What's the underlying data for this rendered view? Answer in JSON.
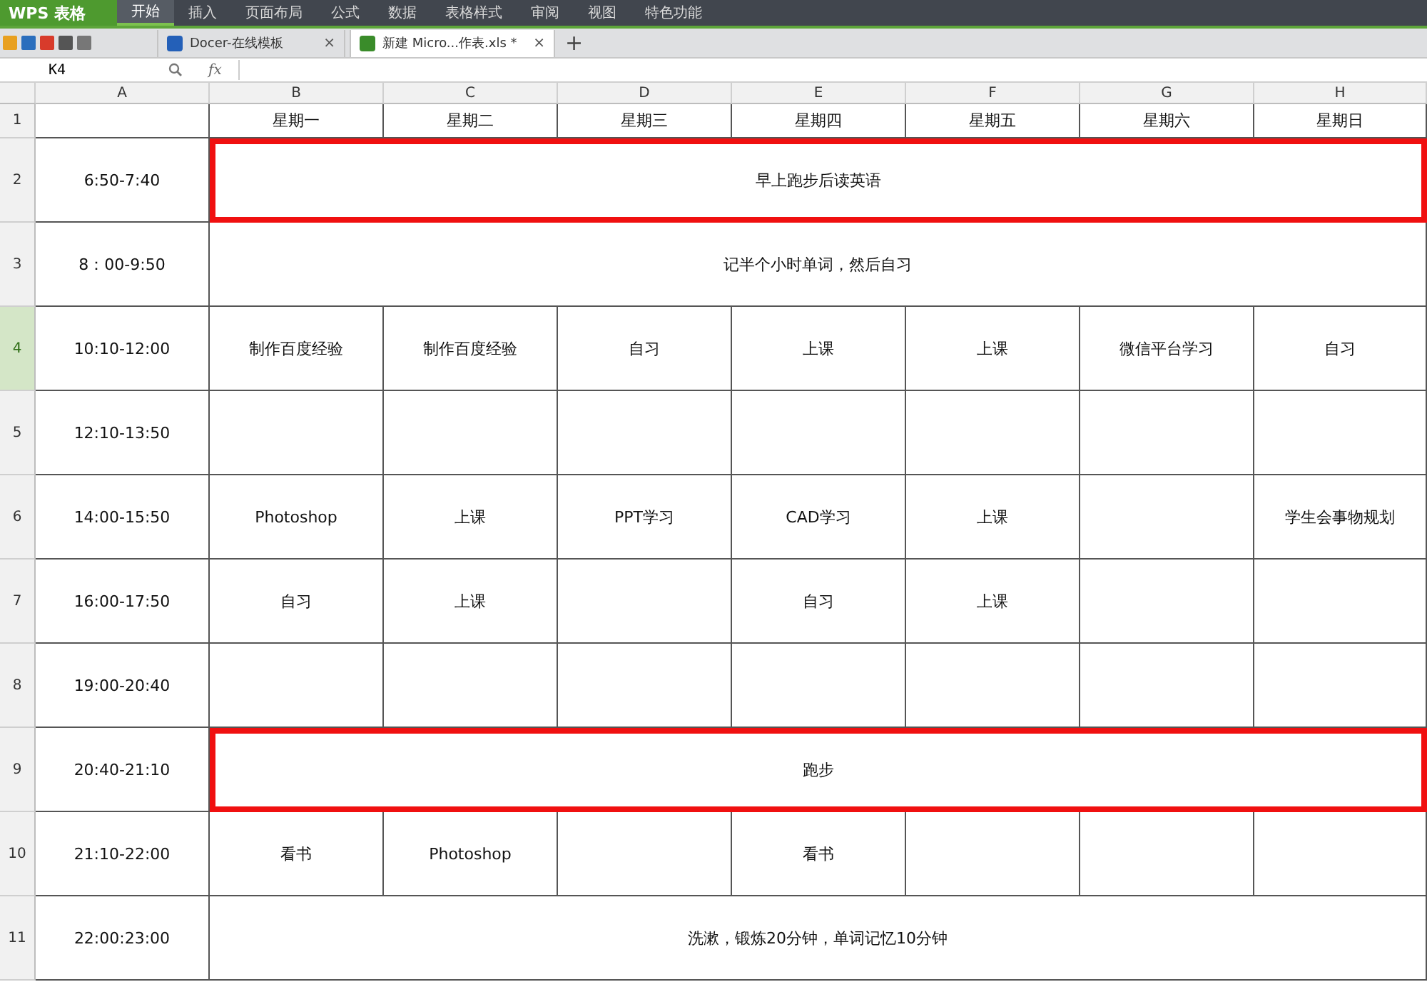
{
  "app": {
    "name": "WPS 表格"
  },
  "menu": [
    {
      "label": "开始",
      "selected": true
    },
    {
      "label": "插入",
      "selected": false
    },
    {
      "label": "页面布局",
      "selected": false
    },
    {
      "label": "公式",
      "selected": false
    },
    {
      "label": "数据",
      "selected": false
    },
    {
      "label": "表格样式",
      "selected": false
    },
    {
      "label": "审阅",
      "selected": false
    },
    {
      "label": "视图",
      "selected": false
    },
    {
      "label": "特色功能",
      "selected": false
    }
  ],
  "doc_tabs": [
    {
      "label": "Docer-在线模板",
      "kind": "docer",
      "selected": false,
      "close": "×"
    },
    {
      "label": "新建 Micro...作表.xls *",
      "kind": "sheet",
      "selected": true,
      "close": "×"
    }
  ],
  "new_tab": "+",
  "formula_bar": {
    "cell": "K4",
    "fx": "fx"
  },
  "columns": [
    "A",
    "B",
    "C",
    "D",
    "E",
    "F",
    "G",
    "H"
  ],
  "rows": [
    {
      "number": "1",
      "selected": false,
      "kind": "normal",
      "cells": [
        "",
        "星期一",
        "星期二",
        "星期三",
        "星期四",
        "星期五",
        "星期六",
        "星期日"
      ]
    },
    {
      "number": "2",
      "selected": false,
      "kind": "merged",
      "highlighted": true,
      "cells": [
        "6:50-7:40",
        "早上跑步后读英语"
      ]
    },
    {
      "number": "3",
      "selected": false,
      "kind": "merged",
      "highlighted": false,
      "cells": [
        "8：00-9:50",
        "记半个小时单词，然后自习"
      ]
    },
    {
      "number": "4",
      "selected": true,
      "kind": "normal",
      "cells": [
        "10:10-12:00",
        "制作百度经验",
        "制作百度经验",
        "自习",
        "上课",
        "上课",
        "微信平台学习",
        "自习"
      ]
    },
    {
      "number": "5",
      "selected": false,
      "kind": "normal",
      "cells": [
        "12:10-13:50",
        "",
        "",
        "",
        "",
        "",
        "",
        ""
      ]
    },
    {
      "number": "6",
      "selected": false,
      "kind": "normal",
      "cells": [
        "14:00-15:50",
        "Photoshop",
        "上课",
        "PPT学习",
        "CAD学习",
        "上课",
        "",
        "学生会事物规划"
      ]
    },
    {
      "number": "7",
      "selected": false,
      "kind": "normal",
      "cells": [
        "16:00-17:50",
        "自习",
        "上课",
        "",
        "自习",
        "上课",
        "",
        ""
      ]
    },
    {
      "number": "8",
      "selected": false,
      "kind": "normal",
      "cells": [
        "19:00-20:40",
        "",
        "",
        "",
        "",
        "",
        "",
        ""
      ]
    },
    {
      "number": "9",
      "selected": false,
      "kind": "merged",
      "highlighted": true,
      "cells": [
        "20:40-21:10",
        "跑步"
      ]
    },
    {
      "number": "10",
      "selected": false,
      "kind": "normal",
      "cells": [
        "21:10-22:00",
        "看书",
        "Photoshop",
        "",
        "看书",
        "",
        "",
        ""
      ]
    },
    {
      "number": "11",
      "selected": false,
      "kind": "merged",
      "highlighted": false,
      "cells": [
        "22:00:23:00",
        "洗漱，锻炼20分钟，单词记忆10分钟"
      ]
    }
  ]
}
